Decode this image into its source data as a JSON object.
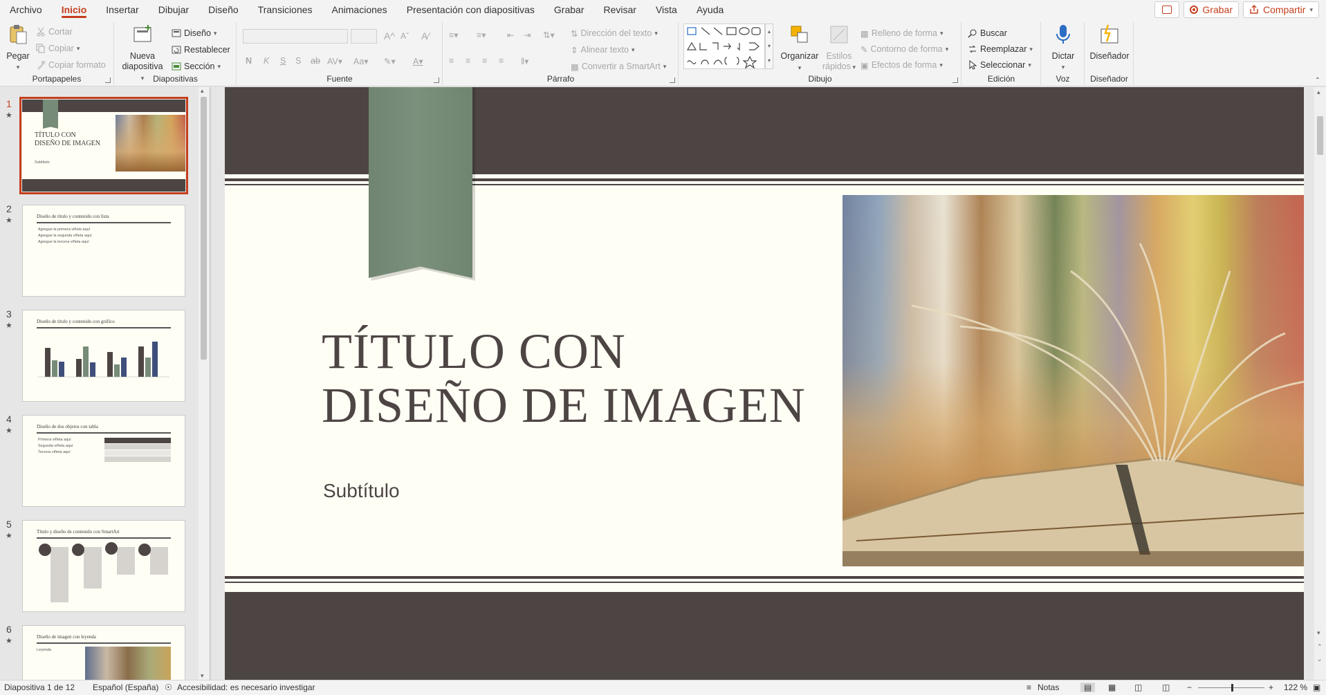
{
  "tabs": [
    "Archivo",
    "Inicio",
    "Insertar",
    "Dibujar",
    "Diseño",
    "Transiciones",
    "Animaciones",
    "Presentación con diapositivas",
    "Grabar",
    "Revisar",
    "Vista",
    "Ayuda"
  ],
  "active_tab": "Inicio",
  "top_right": {
    "record": "Grabar",
    "share": "Compartir"
  },
  "ribbon": {
    "portapapeles": {
      "label": "Portapapeles",
      "paste": "Pegar",
      "cut": "Cortar",
      "copy": "Copiar",
      "format": "Copiar formato"
    },
    "diapositivas": {
      "label": "Diapositivas",
      "new_slide_1": "Nueva",
      "new_slide_2": "diapositiva",
      "layout": "Diseño",
      "reset": "Restablecer",
      "section": "Sección"
    },
    "fuente": {
      "label": "Fuente"
    },
    "parrafo": {
      "label": "Párrafo",
      "text_dir": "Dirección del texto",
      "align_text": "Alinear texto",
      "smartart": "Convertir a SmartArt"
    },
    "dibujo": {
      "label": "Dibujo",
      "arrange": "Organizar",
      "quick_styles_1": "Estilos",
      "quick_styles_2": "rápidos",
      "fill": "Relleno de forma",
      "outline": "Contorno de forma",
      "effects": "Efectos de forma"
    },
    "edicion": {
      "label": "Edición",
      "find": "Buscar",
      "replace": "Reemplazar",
      "select": "Seleccionar"
    },
    "voz": {
      "label": "Voz",
      "dictate": "Dictar"
    },
    "disenador": {
      "label": "Diseñador",
      "designer": "Diseñador"
    }
  },
  "thumbnails": [
    {
      "num": "1",
      "title_1": "TÍTULO CON",
      "title_2": "DISEÑO DE IMAGEN",
      "sub": "Subtítulo"
    },
    {
      "num": "2",
      "title": "Diseño de título y contenido con lista",
      "bullets": [
        "Agregue la primera viñeta aquí",
        "Agregue la segunda viñeta aquí",
        "Agregue la tercera viñeta aquí"
      ]
    },
    {
      "num": "3",
      "title": "Diseño de título y contenido con gráfico"
    },
    {
      "num": "4",
      "title": "Diseño de dos objetos con tabla",
      "bullets": [
        "Primera viñeta aquí",
        "Segunda viñeta aquí",
        "Tercera viñeta aquí"
      ]
    },
    {
      "num": "5",
      "title": "Título y diseño de contenido con SmartArt"
    },
    {
      "num": "6",
      "title": "Diseño de imagen con leyenda",
      "caption": "Leyenda"
    }
  ],
  "slide": {
    "title_line1": "TÍTULO CON",
    "title_line2": "DISEÑO DE IMAGEN",
    "subtitle": "Subtítulo"
  },
  "colors": {
    "accent": "#c43e1c",
    "band": "#4d4543",
    "ribbon_green": "#778c78",
    "slide_bg": "#fffef5"
  },
  "status": {
    "slide_count": "Diapositiva 1 de 12",
    "language": "Español (España)",
    "accessibility": "Accesibilidad: es necesario investigar",
    "notes": "Notas",
    "zoom": "122 %"
  }
}
